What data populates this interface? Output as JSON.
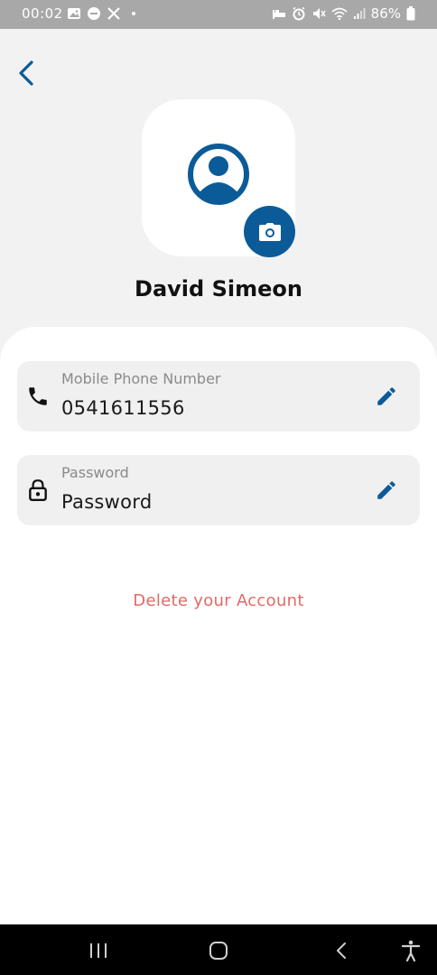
{
  "status_bar": {
    "time": "00:02",
    "battery": "86%",
    "left_icons": [
      "gallery-icon",
      "do-not-disturb-icon",
      "x-logo-icon",
      "dot-icon"
    ],
    "right_icons": [
      "sleep-icon",
      "alarm-icon",
      "mute-icon",
      "wifi-icon",
      "signal-icon",
      "battery-icon"
    ]
  },
  "header": {
    "back_icon": "chevron-left-icon"
  },
  "profile": {
    "name": "David Simeon",
    "avatar_icon": "user-circle-icon",
    "camera_icon": "camera-icon"
  },
  "fields": [
    {
      "label": "Mobile Phone Number",
      "value": "0541611556",
      "icon": "phone-icon",
      "action_icon": "edit-pencil-icon"
    },
    {
      "label": "Password",
      "value": "Password",
      "icon": "lock-icon",
      "action_icon": "edit-pencil-icon"
    }
  ],
  "actions": {
    "delete_account": "Delete your Account"
  },
  "nav_bar": {
    "buttons": [
      "recents-icon",
      "home-icon",
      "back-icon",
      "accessibility-icon"
    ]
  },
  "colors": {
    "accent": "#0b5b98",
    "danger": "#e06a66",
    "background": "#f2f2f2",
    "panel": "#ffffff",
    "field_bg": "#f0f0f0"
  }
}
